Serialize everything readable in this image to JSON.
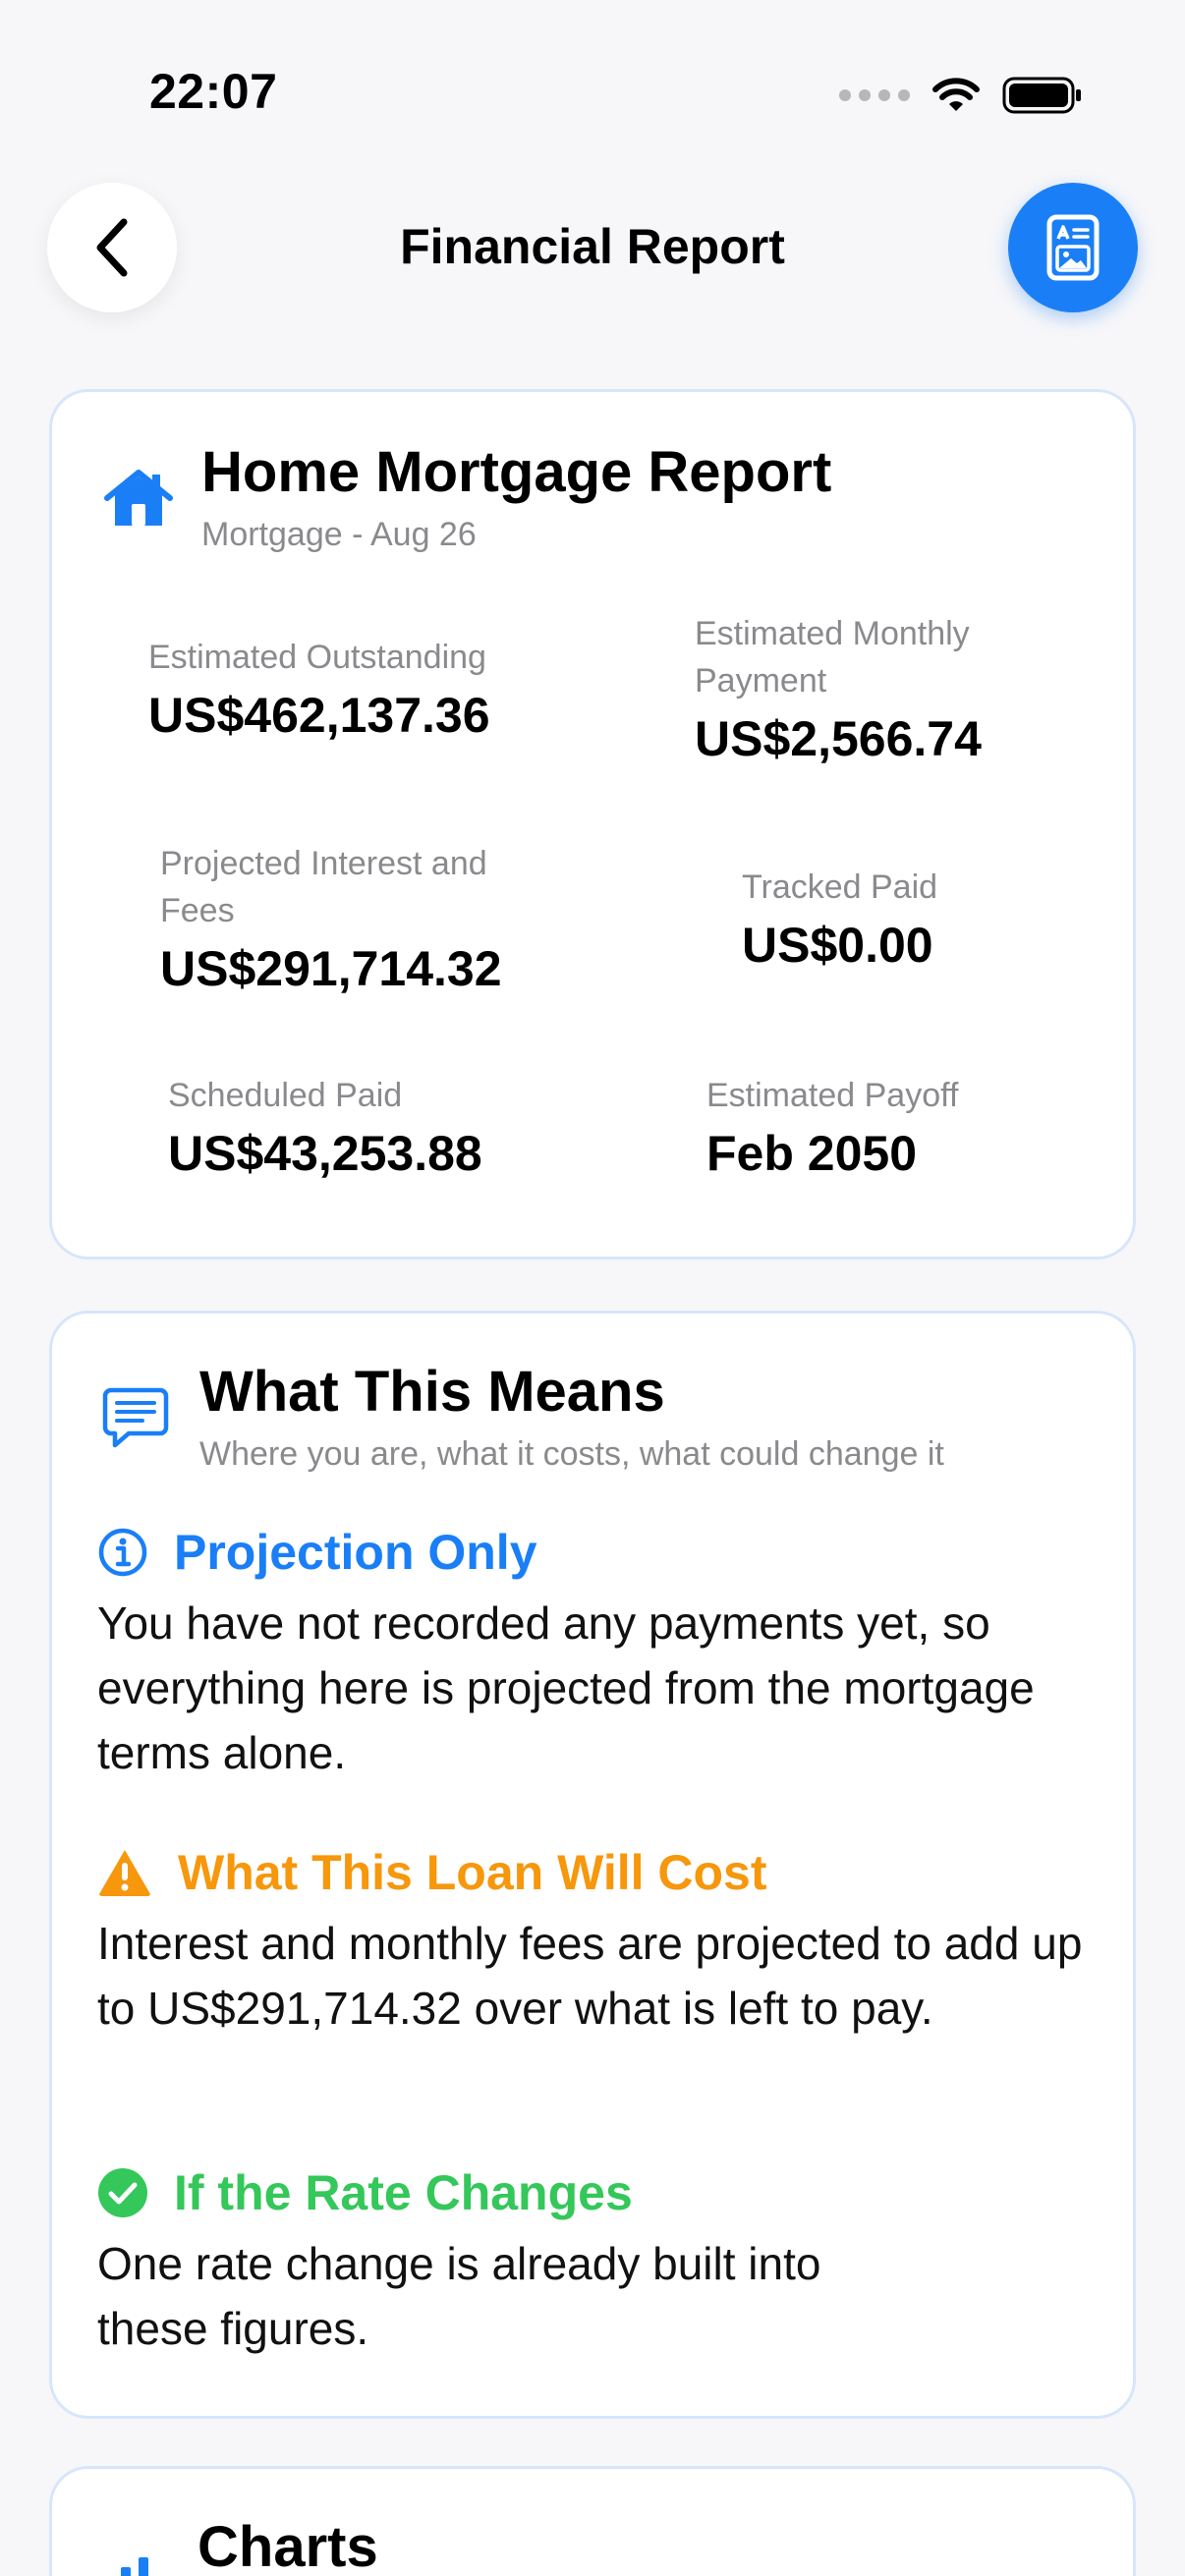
{
  "status_bar": {
    "time": "22:07"
  },
  "nav": {
    "title": "Financial Report"
  },
  "report": {
    "title": "Home Mortgage Report",
    "subtitle": "Mortgage - Aug 26",
    "metrics": [
      {
        "label": "Estimated Outstanding",
        "value": "US$462,137.36"
      },
      {
        "label": "Estimated Monthly Payment",
        "value": "US$2,566.74"
      },
      {
        "label": "Projected Interest and Fees",
        "value": "US$291,714.32"
      },
      {
        "label": "Tracked Paid",
        "value": "US$0.00"
      },
      {
        "label": "Scheduled Paid",
        "value": "US$43,253.88"
      },
      {
        "label": "Estimated Payoff",
        "value": "Feb 2050"
      }
    ]
  },
  "meaning": {
    "title": "What This Means",
    "subtitle": "Where you are, what it costs, what could change it",
    "sections": [
      {
        "title": "Projection Only",
        "body": "You have not recorded any payments yet, so everything here is projected from the mortgage terms alone.",
        "color": "#1a7ff7",
        "icon": "info-circle-icon"
      },
      {
        "title": "What This Loan Will Cost",
        "body": "Interest and monthly fees are projected to add up to US$291,714.32 over what is left to pay.",
        "color": "#f6970c",
        "icon": "warning-triangle-icon"
      },
      {
        "title": "If the Rate Changes",
        "body": "One rate change is already built into these figures.",
        "color": "#34c759",
        "icon": "check-circle-icon"
      }
    ]
  },
  "charts": {
    "title": "Charts"
  },
  "colors": {
    "accent": "#1a7ff7",
    "warning": "#f6970c",
    "success": "#34c759",
    "card_border": "#d6e6fb"
  }
}
